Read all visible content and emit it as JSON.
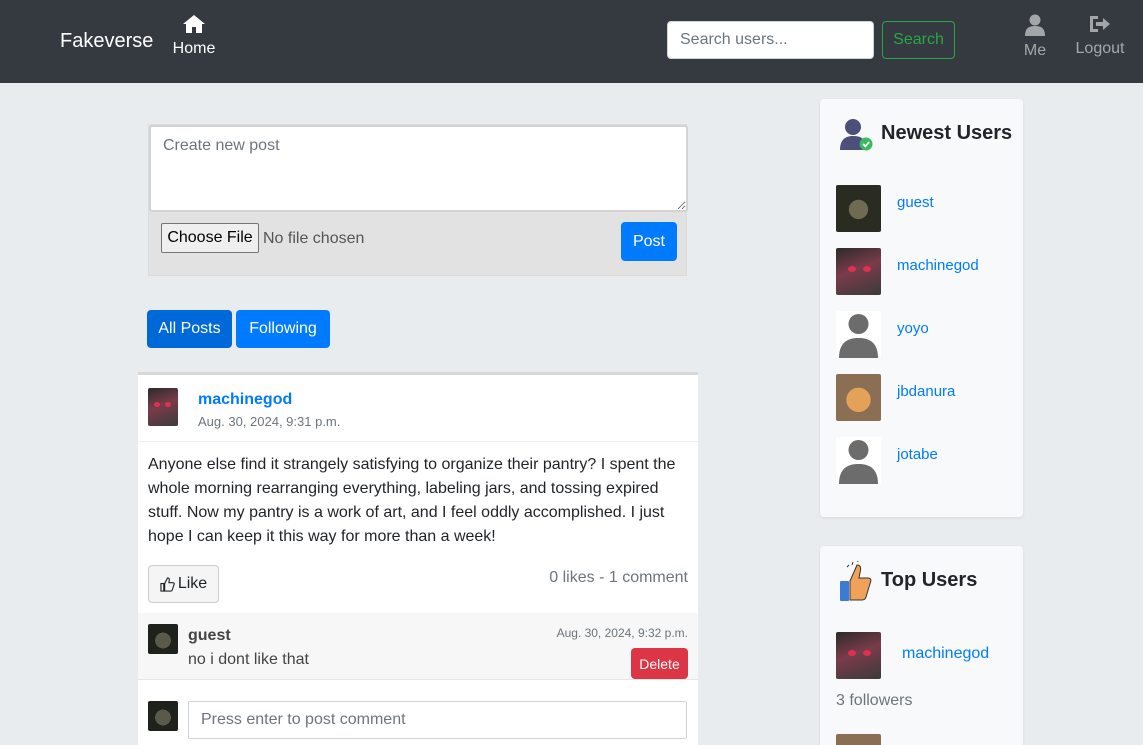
{
  "navbar": {
    "brand": "Fakeverse",
    "home_label": "Home",
    "search_placeholder": "Search users...",
    "search_button": "Search",
    "me_label": "Me",
    "logout_label": "Logout"
  },
  "create_post": {
    "placeholder": "Create new post",
    "file_button": "Choose File",
    "file_status": "No file chosen",
    "post_button": "Post"
  },
  "tabs": [
    {
      "label": "All Posts",
      "active": true
    },
    {
      "label": "Following",
      "active": false
    }
  ],
  "post": {
    "author": "machinegod",
    "date": "Aug. 30, 2024, 9:31 p.m.",
    "body": "Anyone else find it strangely satisfying to organize their pantry? I spent the whole morning rearranging everything, labeling jars, and tossing expired stuff. Now my pantry is a work of art, and I feel oddly accomplished. I just hope I can keep it this way for more than a week!",
    "like_button": "Like",
    "stats": "0 likes - 1 comment",
    "comments": [
      {
        "author": "guest",
        "text": "no i dont like that",
        "date": "Aug. 30, 2024, 9:32 p.m.",
        "delete_label": "Delete"
      }
    ],
    "comment_placeholder": "Press enter to post comment"
  },
  "sidebar": {
    "newest_title": "Newest Users",
    "newest_users": [
      {
        "name": "guest",
        "avatar": "monkey"
      },
      {
        "name": "machinegod",
        "avatar": "robot"
      },
      {
        "name": "yoyo",
        "avatar": "default"
      },
      {
        "name": "jbdanura",
        "avatar": "cat"
      },
      {
        "name": "jotabe",
        "avatar": "default"
      }
    ],
    "top_title": "Top Users",
    "top_users": [
      {
        "name": "machinegod",
        "followers": "3 followers",
        "avatar": "robot"
      }
    ]
  },
  "colors": {
    "navbar": "#343a40",
    "primary": "#007bff",
    "success": "#28a745",
    "danger": "#dc3545",
    "background": "#e9ecef"
  }
}
